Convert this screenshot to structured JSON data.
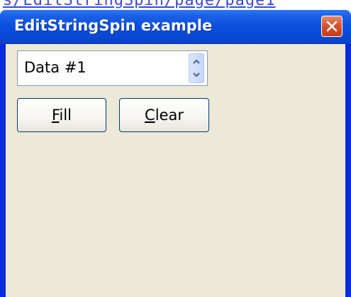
{
  "background": {
    "link_text": "s/EditStringSpin/page/page1"
  },
  "window": {
    "title": "EditStringSpin example",
    "close_icon": "close-icon"
  },
  "spin_edit": {
    "value": "Data #1",
    "up_icon": "chevron-up-icon",
    "down_icon": "chevron-down-icon"
  },
  "buttons": {
    "fill": {
      "accel": "F",
      "rest": "ill"
    },
    "clear": {
      "accel": "C",
      "rest": "lear"
    }
  },
  "colors": {
    "titlebar": "#0a4fdc",
    "client_bg": "#ece9d8",
    "close_button": "#d8542e",
    "border": "#0a2ad8"
  }
}
